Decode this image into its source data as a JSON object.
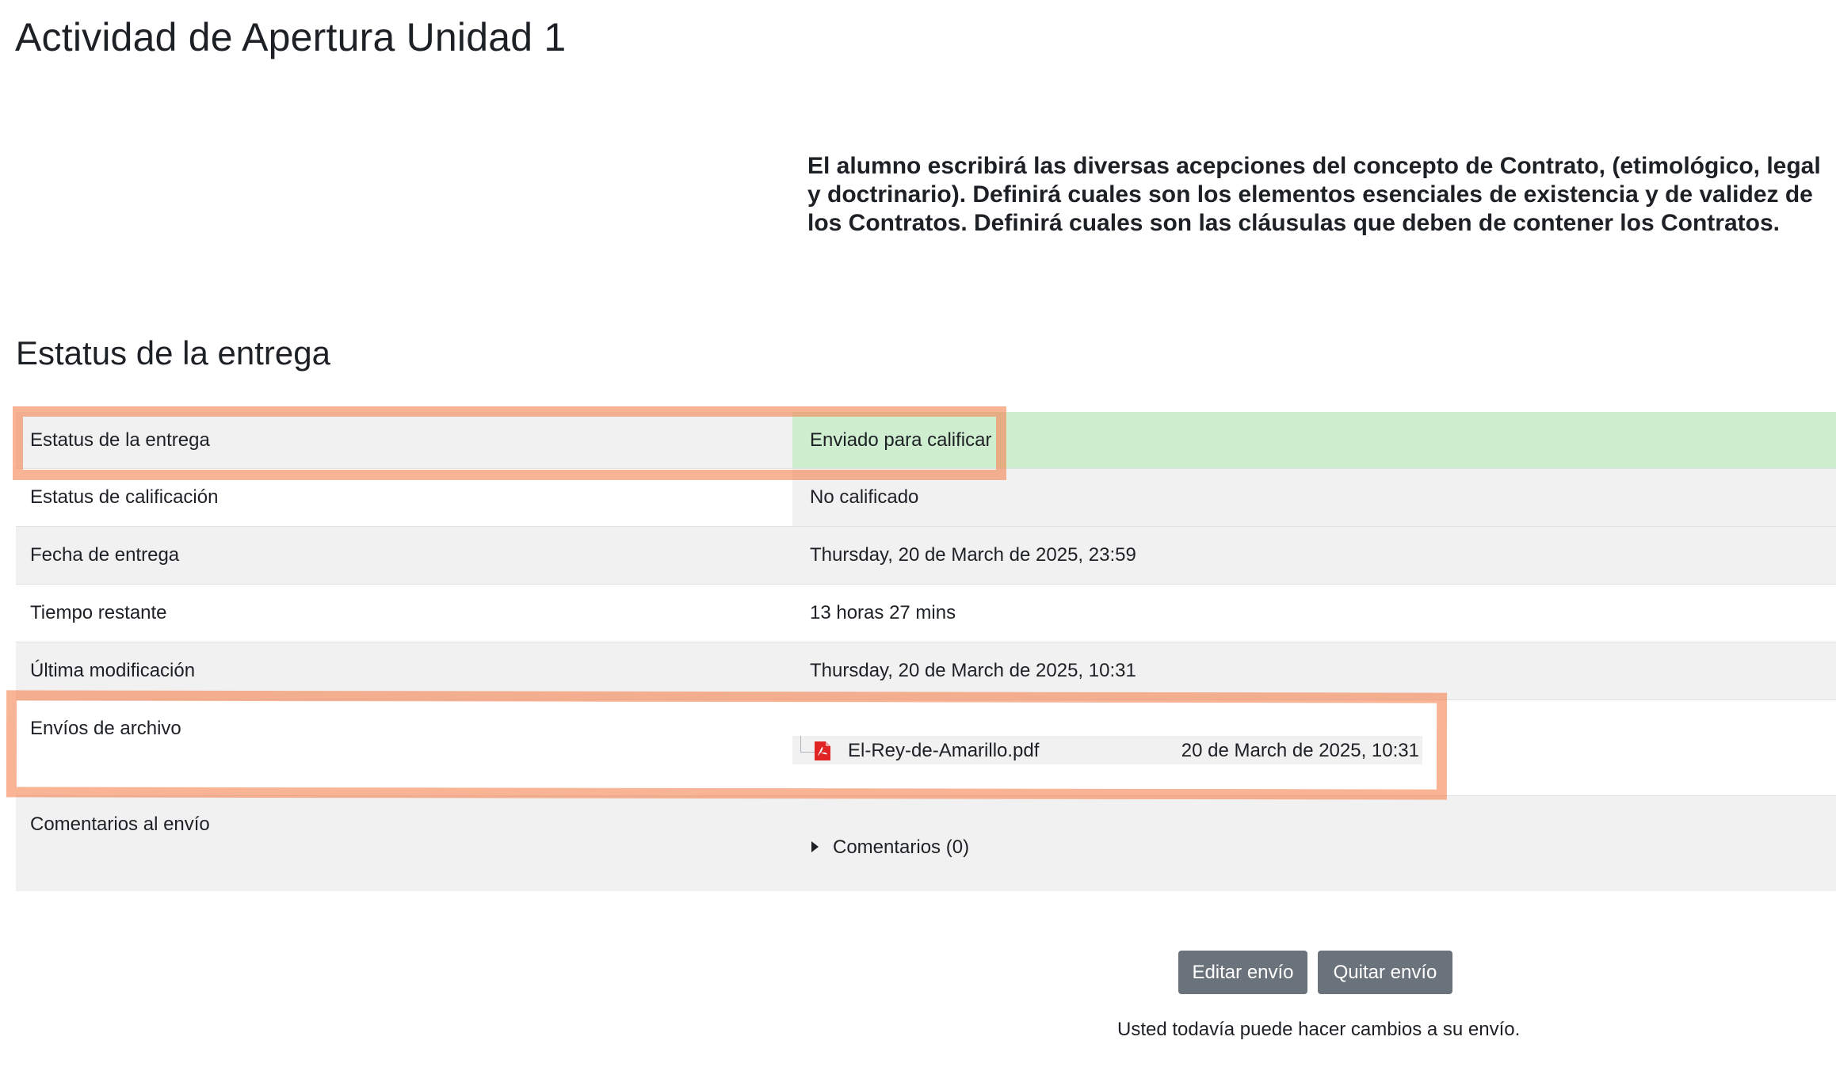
{
  "page": {
    "title": "Actividad de Apertura Unidad 1",
    "intro": "El alumno escribirá las diversas acepciones del concepto de Contrato, (etimológico, legal y doctrinario). Definirá cuales son los elementos esenciales de existencia y de validez de los Contratos. Definirá cuales son las cláusulas que deben de contener los Contratos."
  },
  "status": {
    "heading": "Estatus de la entrega",
    "rows": [
      {
        "label": "Estatus de la entrega",
        "value": "Enviado para calificar"
      },
      {
        "label": "Estatus de calificación",
        "value": "No calificado"
      },
      {
        "label": "Fecha de entrega",
        "value": "Thursday, 20 de March de 2025, 23:59"
      },
      {
        "label": "Tiempo restante",
        "value": "13 horas 27 mins"
      },
      {
        "label": "Última modificación",
        "value": "Thursday, 20 de March de 2025, 10:31"
      },
      {
        "label": "Envíos de archivo",
        "value": ""
      },
      {
        "label": "Comentarios al envío",
        "value": ""
      }
    ],
    "file": {
      "name": "El-Rey-de-Amarillo.pdf",
      "date": "20 de March de 2025, 10:31",
      "icon": "pdf-icon"
    },
    "comments_toggle": "Comentarios (0)"
  },
  "actions": {
    "edit_label": "Editar envío",
    "remove_label": "Quitar envío",
    "note": "Usted todavía puede hacer cambios a su envío."
  },
  "colors": {
    "success_bg": "#cfeecf",
    "stripe_bg": "#f1f1f1",
    "button_bg": "#6a737b",
    "highlight": "#f58250"
  }
}
